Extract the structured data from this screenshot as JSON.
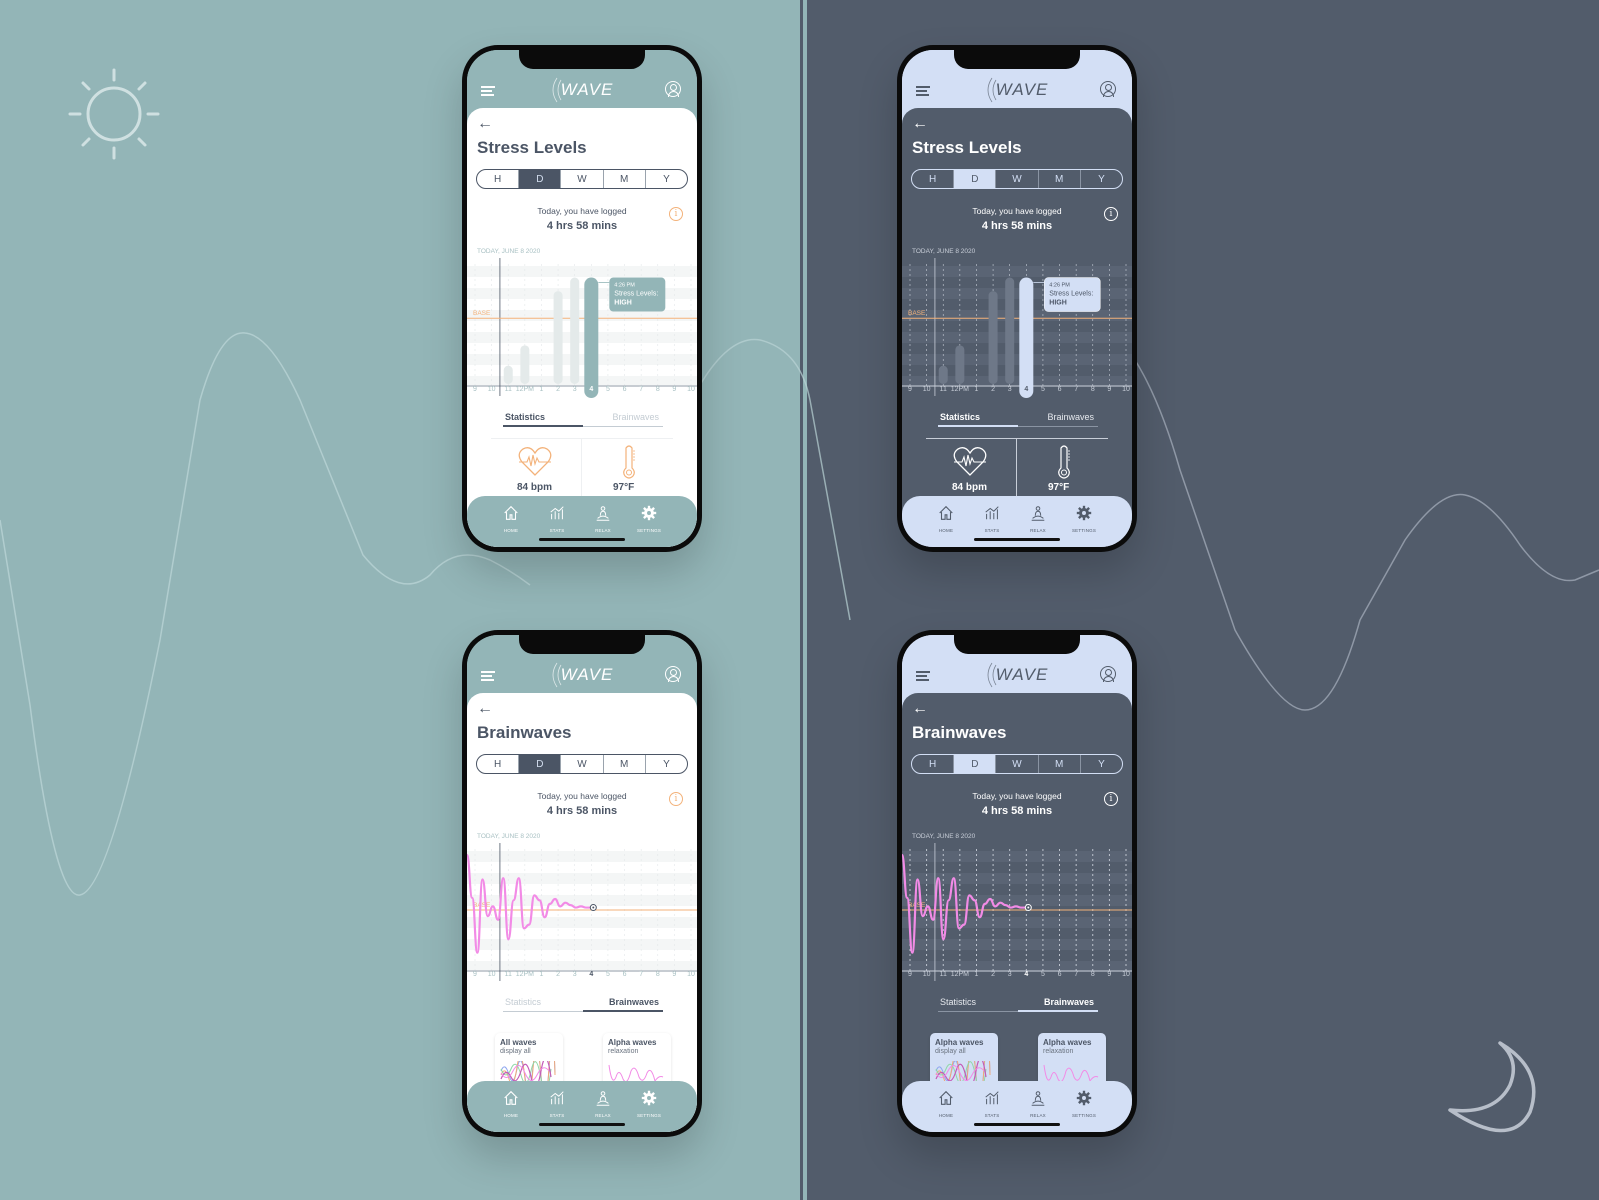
{
  "theme": {
    "light_bg": "#93b5b7",
    "dark_bg": "#525c6b",
    "light_accent": "#93b5b7",
    "dark_accent": "#d3dff5",
    "text_dark": "#4b5565",
    "base_line": "#f3b27a",
    "wave_color": "#f28be6"
  },
  "decor": {
    "sun_icon": "sun-icon",
    "moon_icon": "moon-icon"
  },
  "app": {
    "logo": "WAVE",
    "back_glyph": "←",
    "info_glyph": "i",
    "segments": [
      "H",
      "D",
      "W",
      "M",
      "Y"
    ],
    "selected_segment": "D",
    "logged_label": "Today, you have logged",
    "logged_value": "4 hrs 58 mins",
    "date_label": "TODAY, JUNE 8 2020",
    "base_label": "BASE",
    "hour_ticks": [
      "9",
      "10",
      "11",
      "12PM",
      "1",
      "2",
      "3",
      "4",
      "5",
      "6",
      "7",
      "8",
      "9",
      "10"
    ],
    "active_hour": "4",
    "tabs": [
      "Statistics",
      "Brainwaves"
    ],
    "nav": [
      {
        "icon": "home-icon",
        "label": "HOME"
      },
      {
        "icon": "stats-icon",
        "label": "STATS"
      },
      {
        "icon": "relax-icon",
        "label": "RELAX"
      },
      {
        "icon": "settings-icon",
        "label": "SETTINGS"
      }
    ]
  },
  "screens": {
    "stress_light": {
      "title": "Stress Levels",
      "active_tab": "Statistics",
      "tooltip": {
        "time": "4:26 PM",
        "label": "Stress Levels:",
        "value": "HIGH"
      },
      "stats": [
        {
          "icon": "heart-rate-icon",
          "value": "84 bpm"
        },
        {
          "icon": "thermometer-icon",
          "value": "97°F"
        }
      ]
    },
    "stress_dark": {
      "title": "Stress Levels",
      "active_tab": "Statistics",
      "tooltip": {
        "time": "4:26 PM",
        "label": "Stress Levels:",
        "value": "HIGH"
      },
      "stats": [
        {
          "icon": "heart-rate-icon",
          "value": "84 bpm"
        },
        {
          "icon": "thermometer-icon",
          "value": "97°F"
        }
      ]
    },
    "brain_light": {
      "title": "Brainwaves",
      "active_tab": "Brainwaves",
      "cards": [
        {
          "title": "All waves",
          "subtitle": "display all"
        },
        {
          "title": "Alpha waves",
          "subtitle": "relaxation"
        }
      ]
    },
    "brain_dark": {
      "title": "Brainwaves",
      "active_tab": "Brainwaves",
      "cards": [
        {
          "title": "Alpha waves",
          "subtitle": "display all"
        },
        {
          "title": "Alpha waves",
          "subtitle": "relaxation"
        }
      ]
    }
  },
  "chart_data": [
    {
      "type": "bar",
      "title": "Stress Levels",
      "subtitle": "TODAY, JUNE 8 2020",
      "categories": [
        "9",
        "10",
        "11",
        "12PM",
        "1",
        "2",
        "3",
        "4",
        "5",
        "6",
        "7",
        "8",
        "9",
        "10"
      ],
      "values": [
        0,
        0,
        1.5,
        3,
        0,
        7,
        8,
        8,
        0,
        0,
        0,
        0,
        0,
        0
      ],
      "highlight": "4",
      "reference_line": {
        "label": "BASE",
        "value": 5
      },
      "ylim": [
        0,
        9
      ],
      "xlabel": "",
      "ylabel": ""
    },
    {
      "type": "line",
      "title": "Brainwaves",
      "subtitle": "TODAY, JUNE 8 2020",
      "x": [
        0,
        0.3,
        0.6,
        0.9,
        1.2,
        1.5,
        1.8,
        2.1,
        2.4,
        2.7,
        3.0,
        3.3,
        3.6,
        3.9,
        4.2,
        4.5,
        4.8,
        5.1,
        5.4,
        5.7,
        6.0,
        6.3,
        6.6,
        6.9,
        7.2
      ],
      "values": [
        4.5,
        1,
        -3.5,
        2.5,
        -0.5,
        0.3,
        -0.8,
        2.6,
        -2.4,
        0.8,
        2.6,
        -1.5,
        -1.2,
        1.2,
        0.8,
        -0.6,
        0.5,
        0.9,
        0.3,
        0.6,
        0.4,
        0.2,
        0.3,
        0.2,
        0.2
      ],
      "reference_line": {
        "label": "BASE",
        "value": 0
      },
      "ylim": [
        -5,
        5
      ],
      "xlabel": "",
      "ylabel": ""
    }
  ]
}
